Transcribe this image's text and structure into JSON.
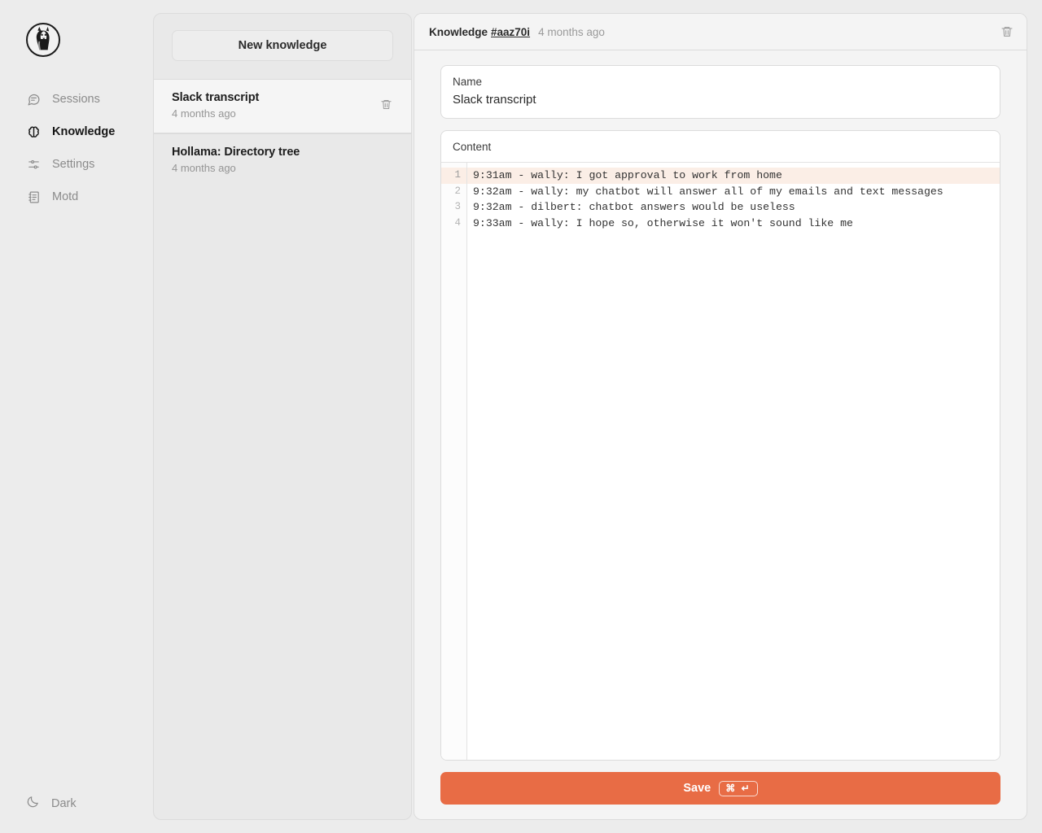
{
  "sidebar": {
    "logo_name": "hollama-llama-logo",
    "items": [
      {
        "label": "Sessions",
        "icon": "message-square-icon",
        "active": false
      },
      {
        "label": "Knowledge",
        "icon": "brain-icon",
        "active": true
      },
      {
        "label": "Settings",
        "icon": "sliders-icon",
        "active": false
      },
      {
        "label": "Motd",
        "icon": "notebook-icon",
        "active": false
      }
    ],
    "theme_toggle": {
      "label": "Dark",
      "icon": "moon-icon"
    }
  },
  "list_panel": {
    "new_button_label": "New knowledge",
    "items": [
      {
        "title": "Slack transcript",
        "subtitle": "4 months ago",
        "selected": true,
        "delete_icon": "trash-icon"
      },
      {
        "title": "Hollama: Directory tree",
        "subtitle": "4 months ago",
        "selected": false,
        "delete_icon": ""
      }
    ]
  },
  "main": {
    "header": {
      "title": "Knowledge",
      "id": "#aaz70i",
      "timestamp": "4 months ago",
      "delete_icon": "trash-icon"
    },
    "name_field": {
      "label": "Name",
      "value": "Slack transcript",
      "placeholder": "Name"
    },
    "content_field": {
      "label": "Content",
      "lines": [
        {
          "number": "1",
          "text": "9:31am - wally: I got approval to work from home",
          "active": true
        },
        {
          "number": "2",
          "text": "9:32am - wally: my chatbot will answer all of my emails and text messages",
          "active": false
        },
        {
          "number": "3",
          "text": "9:32am - dilbert: chatbot answers would be useless",
          "active": false
        },
        {
          "number": "4",
          "text": "9:33am - wally: I hope so, otherwise it won't sound like me",
          "active": false
        }
      ]
    },
    "save": {
      "label": "Save",
      "shortcut": "⌘ ↵"
    }
  },
  "colors": {
    "accent": "#e86c45",
    "active_line": "#fbeee6",
    "page_bg": "#ececec",
    "panel_bg": "#f4f4f4",
    "list_bg": "#e9e9e9"
  }
}
